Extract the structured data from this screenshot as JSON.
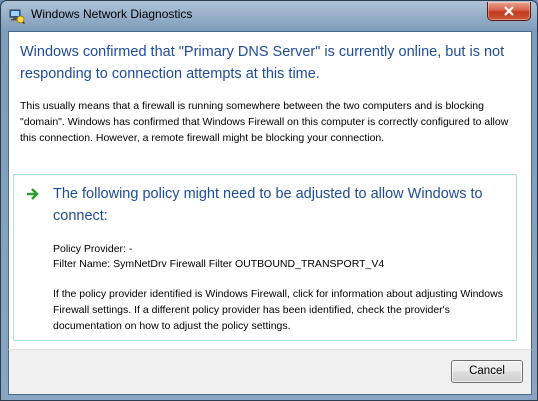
{
  "window": {
    "title": "Windows Network Diagnostics",
    "title_icon": "network-diagnostics-icon",
    "close_icon": "close-icon"
  },
  "message": {
    "headline": "Windows confirmed that \"Primary DNS Server\" is currently online, but is not responding to connection attempts at this time.",
    "description": "This usually means that a firewall is running somewhere between the two computers and is blocking \"domain\".  Windows has confirmed that Windows Firewall on this computer is correctly configured to allow this connection. However, a remote firewall might be blocking your connection."
  },
  "policy": {
    "arrow_icon": "green-arrow-icon",
    "headline": "The following policy might need to be adjusted to allow Windows to connect:",
    "provider_line": "Policy Provider: -",
    "filter_line": "Filter Name: SymNetDrv Firewall Filter OUTBOUND_TRANSPORT_V4",
    "help_text": "If the policy provider identified is Windows Firewall, click for information about adjusting Windows Firewall settings. If a different policy provider has been identified, check the provider's documentation on how to adjust the policy settings."
  },
  "footer": {
    "cancel_label": "Cancel"
  },
  "colors": {
    "headline_blue": "#1f4c9a",
    "arrow_green": "#2e9e2e",
    "policy_border": "#a9dbe8"
  }
}
